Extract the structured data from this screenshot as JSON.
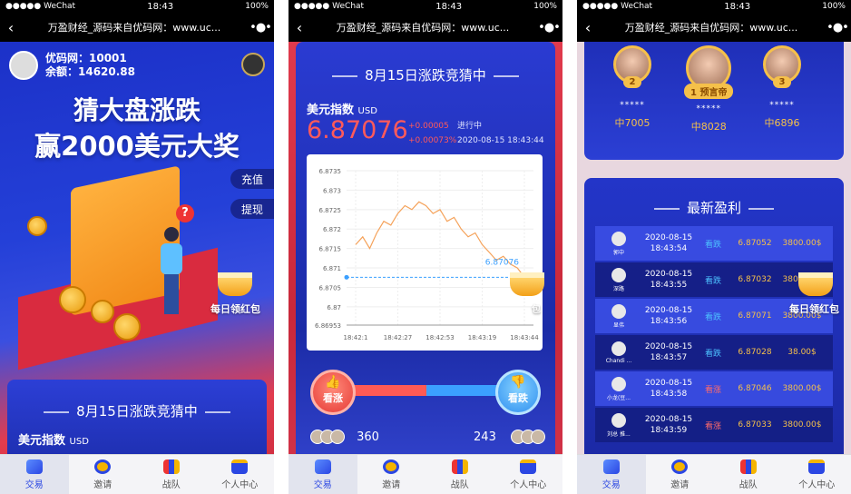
{
  "status": {
    "carrier": "●●●●● WeChat",
    "time": "18:43",
    "battery": "100%"
  },
  "navbar": {
    "title": "万盈财经_源码来自优码网：www.uc..."
  },
  "tabs": [
    "交易",
    "邀请",
    "战队",
    "个人中心"
  ],
  "screen1": {
    "user_code": "优码网：10001",
    "balance": "余额：14620.88",
    "headline1": "猜大盘涨跌",
    "headline2": "赢2000美元大奖",
    "recharge": "充值",
    "withdraw": "提现",
    "daily_redpack": "每日领红包",
    "card_title": "8月15日涨跌竞猜中",
    "index_name": "美元指数",
    "index_unit": "USD"
  },
  "screen2": {
    "title": "8月15日涨跌竞猜中",
    "index_name": "美元指数",
    "index_unit": "USD",
    "price": "6.87076",
    "change_abs": "+0.00005",
    "change_pct": "+0.00073%",
    "status": "进行中",
    "datetime": "2020-08-15 18:43:44",
    "up_label": "看涨",
    "down_label": "看跌",
    "up_count": "360",
    "down_count": "243",
    "daily_redpack": "每日领红包",
    "colors": {
      "up": "#ff5a55",
      "down": "#3ba0ff",
      "line": "#f5a25a"
    }
  },
  "chart_data": {
    "type": "line",
    "x_ticks": [
      "18:42:1",
      "18:42:27",
      "18:42:53",
      "18:43:19",
      "18:43:44"
    ],
    "y_ticks": [
      "6.86953",
      "6.87",
      "6.8705",
      "6.871",
      "6.8715",
      "6.872",
      "6.8725",
      "6.873",
      "6.8735"
    ],
    "ylim": [
      6.86953,
      6.8735
    ],
    "series": [
      {
        "values": [
          6.8716,
          6.8718,
          6.8715,
          6.8719,
          6.8722,
          6.8721,
          6.8724,
          6.8726,
          6.8725,
          6.8727,
          6.8726,
          6.8724,
          6.8725,
          6.8722,
          6.8723,
          6.872,
          6.8718,
          6.8719,
          6.8716,
          6.8714,
          6.8712,
          6.8713,
          6.8711,
          6.871,
          6.87076
        ]
      }
    ],
    "current_label": "6.87076",
    "current_value": 6.87076,
    "grid": true
  },
  "screen3": {
    "ranks": [
      {
        "tag": "2",
        "stars": "*****",
        "name": "中7005"
      },
      {
        "tag": "1 预言帝",
        "stars": "*****",
        "name": "中8028"
      },
      {
        "tag": "3",
        "stars": "*****",
        "name": "中6896"
      }
    ],
    "latest_title": "最新盈利",
    "daily_redpack": "每日领红包",
    "rows": [
      {
        "user": "郭中",
        "date": "2020-08-15",
        "time": "18:43:54",
        "dir": "看跌",
        "price": "6.87052",
        "amt": "3800.00$"
      },
      {
        "user": "深路",
        "date": "2020-08-15",
        "time": "18:43:55",
        "dir": "看跌",
        "price": "6.87032",
        "amt": "3800.00$"
      },
      {
        "user": "显伟",
        "date": "2020-08-15",
        "time": "18:43:56",
        "dir": "看跌",
        "price": "6.87071",
        "amt": "3800.00$"
      },
      {
        "user": "Chandi ...",
        "date": "2020-08-15",
        "time": "18:43:57",
        "dir": "看跌",
        "price": "6.87028",
        "amt": "38.00$"
      },
      {
        "user": "小龙(豆...",
        "date": "2020-08-15",
        "time": "18:43:58",
        "dir": "看涨",
        "price": "6.87046",
        "amt": "3800.00$"
      },
      {
        "user": "刘总 推...",
        "date": "2020-08-15",
        "time": "18:43:59",
        "dir": "看涨",
        "price": "6.87033",
        "amt": "3800.00$"
      }
    ]
  }
}
